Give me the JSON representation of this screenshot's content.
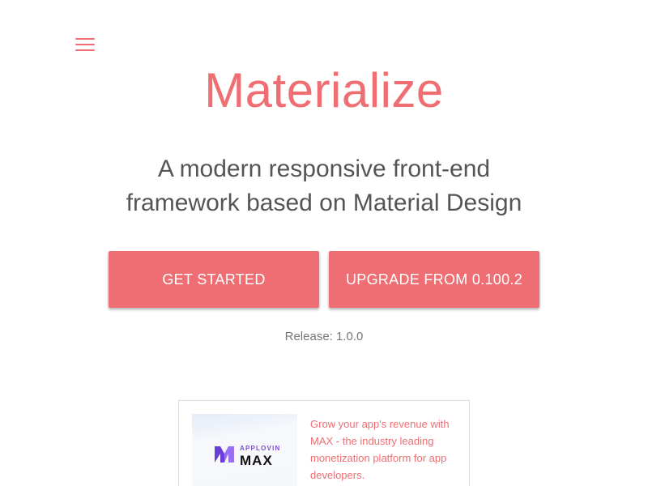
{
  "header": {
    "menu_icon": "hamburger-menu-icon",
    "brand": "Materialize"
  },
  "hero": {
    "tagline_line1": "A modern responsive front-end",
    "tagline_line2": "framework based on Material Design"
  },
  "actions": {
    "get_started_label": "GET STARTED",
    "upgrade_label": "UPGRADE FROM 0.100.2"
  },
  "release": {
    "text": "Release: 1.0.0"
  },
  "ad": {
    "logo_small": "APPLOVIN",
    "logo_big": "MAX",
    "text": "Grow your app's revenue with MAX - the industry leading monetization platform for app developers."
  },
  "colors": {
    "accent": "#ee6e73",
    "text": "#555555",
    "muted": "#777777",
    "logo_purple": "#7b4dd8"
  }
}
